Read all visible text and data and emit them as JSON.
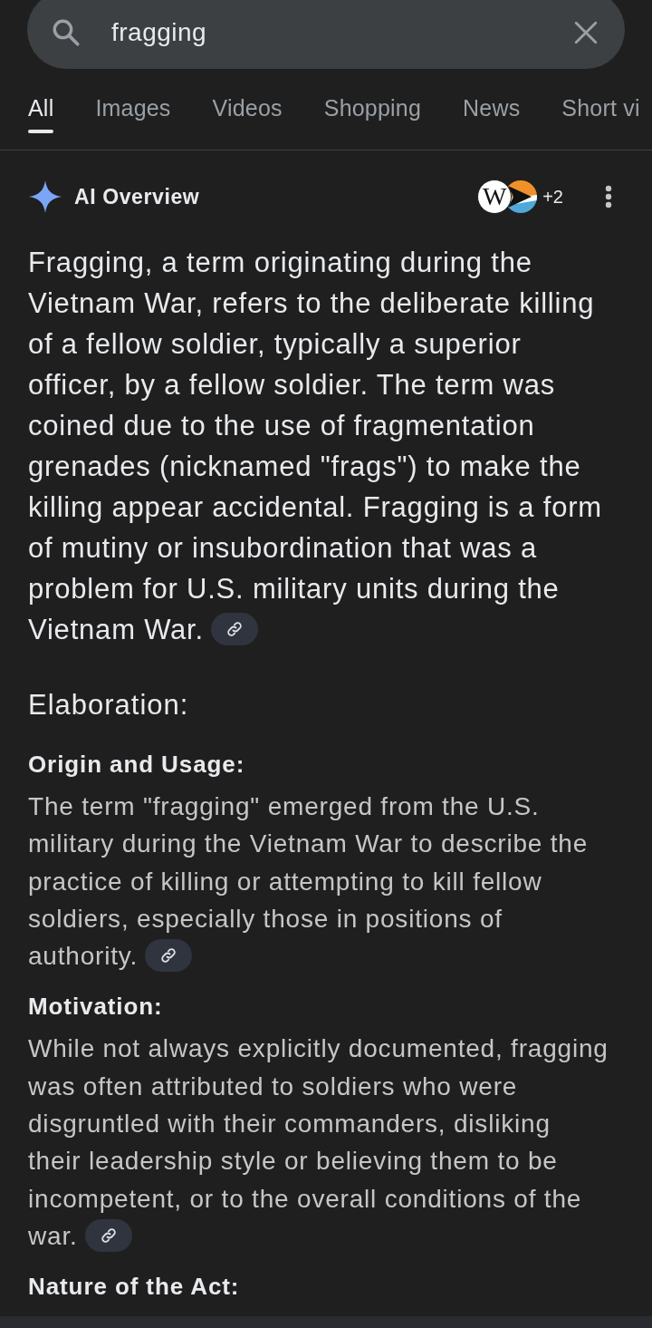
{
  "search": {
    "query": "fragging"
  },
  "tabs": [
    {
      "label": "All",
      "selected": true
    },
    {
      "label": "Images",
      "selected": false
    },
    {
      "label": "Videos",
      "selected": false
    },
    {
      "label": "Shopping",
      "selected": false
    },
    {
      "label": "News",
      "selected": false
    },
    {
      "label": "Short vi",
      "selected": false
    }
  ],
  "ai_overview": {
    "title": "AI Overview",
    "sources": [
      {
        "kind": "letter",
        "text": "W"
      },
      {
        "kind": "arrow"
      }
    ],
    "more_sources": "+2",
    "summary": {
      "text": "Fragging, a term originating during the Vietnam War, refers to the deliberate killing of a fellow soldier, typically a superior officer, by a fellow soldier. The term was coined due to the use of fragmentation grenades (nicknamed \"frags\") to make the killing appear accidental. Fragging is a form of mutiny or insubordination that was a problem for U.S. military units during the Vietnam War.",
      "citation_link": true
    },
    "elaboration_heading": "Elaboration:",
    "sections": [
      {
        "heading": "Origin and Usage:",
        "text": "The term \"fragging\" emerged from the U.S. military during the Vietnam War to describe the practice of killing or attempting to kill fellow soldiers, especially those in positions of authority.",
        "citation_link": true
      },
      {
        "heading": "Motivation:",
        "text": "While not always explicitly documented, fragging was often attributed to soldiers who were disgruntled with their commanders, disliking their leadership style or believing them to be incompetent, or to the overall conditions of the war.",
        "citation_link": true
      },
      {
        "heading": "Nature of the Act:"
      }
    ]
  }
}
